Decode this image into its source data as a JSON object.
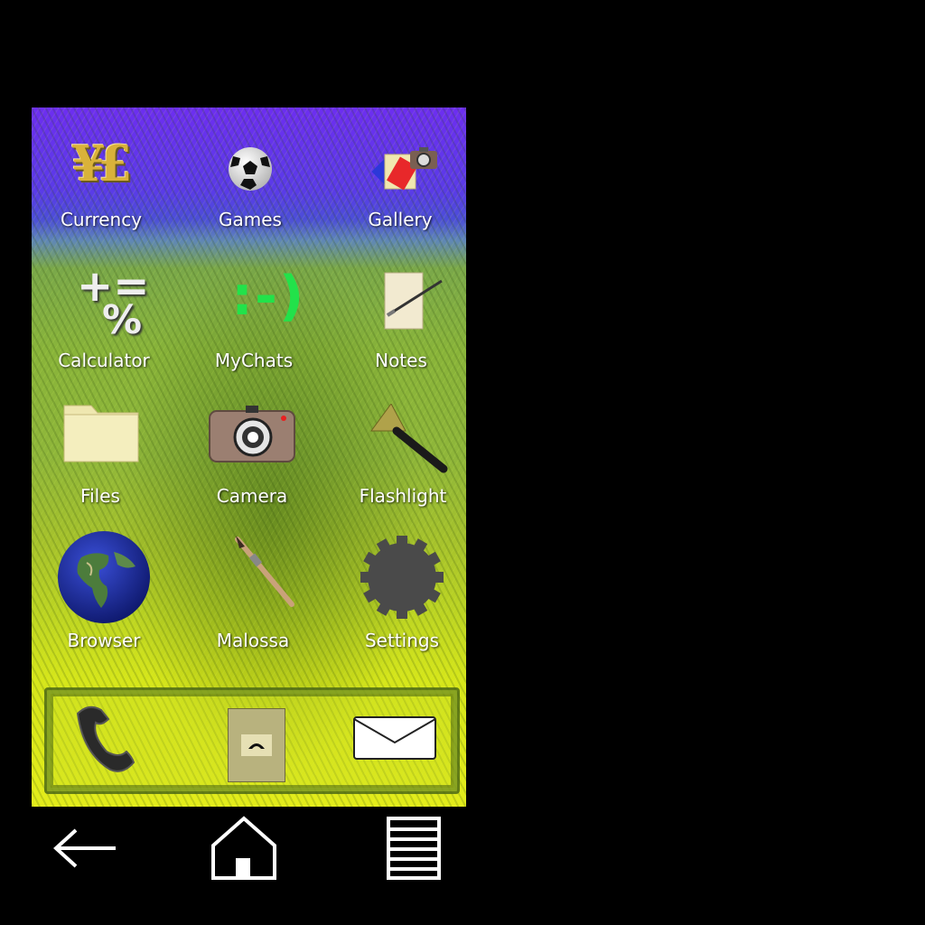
{
  "apps": [
    {
      "label": "Currency",
      "icon": "currency-icon"
    },
    {
      "label": "Games",
      "icon": "soccer-ball-icon"
    },
    {
      "label": "Gallery",
      "icon": "gallery-icon"
    },
    {
      "label": "Calculator",
      "icon": "calculator-icon"
    },
    {
      "label": "MyChats",
      "icon": "smiley-chat-icon"
    },
    {
      "label": "Notes",
      "icon": "notepad-icon"
    },
    {
      "label": "Files",
      "icon": "folder-icon"
    },
    {
      "label": "Camera",
      "icon": "camera-icon"
    },
    {
      "label": "Flashlight",
      "icon": "flashlight-icon"
    },
    {
      "label": "Browser",
      "icon": "globe-icon"
    },
    {
      "label": "Malossa",
      "icon": "paintbrush-icon"
    },
    {
      "label": "Settings",
      "icon": "gear-icon"
    }
  ],
  "dock": [
    {
      "name": "phone",
      "icon": "phone-handset-icon"
    },
    {
      "name": "contacts",
      "icon": "address-book-icon"
    },
    {
      "name": "messages",
      "icon": "envelope-icon"
    }
  ],
  "navbar": [
    {
      "name": "back",
      "icon": "back-arrow-icon"
    },
    {
      "name": "home",
      "icon": "home-icon"
    },
    {
      "name": "menu",
      "icon": "menu-lines-icon"
    }
  ],
  "calculator_glyphs": {
    "top": "+=",
    "bottom": "%"
  },
  "mychats_glyph": ":-)",
  "currency_glyph": "¥£"
}
